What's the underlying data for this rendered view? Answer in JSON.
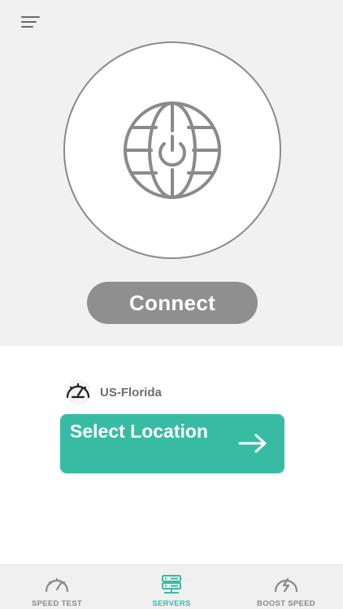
{
  "colors": {
    "accent": "#37bca3",
    "connect_button": "#8f8f8f",
    "icon_gray": "#8a8a8a",
    "top_background": "#f1f1f1"
  },
  "header": {
    "menu_icon": "menu-icon"
  },
  "main": {
    "power_icon": "globe-power-icon",
    "connect_label": "Connect"
  },
  "location": {
    "icon": "speedometer-icon",
    "current": "US-Florida",
    "select_label": "Select Location",
    "arrow_icon": "arrow-right-icon"
  },
  "tabs": [
    {
      "label": "SPEED TEST",
      "icon": "gauge-icon",
      "active": false
    },
    {
      "label": "SERVERS",
      "icon": "server-icon",
      "active": true
    },
    {
      "label": "BOOST SPEED",
      "icon": "boost-gauge-icon",
      "active": false
    }
  ]
}
